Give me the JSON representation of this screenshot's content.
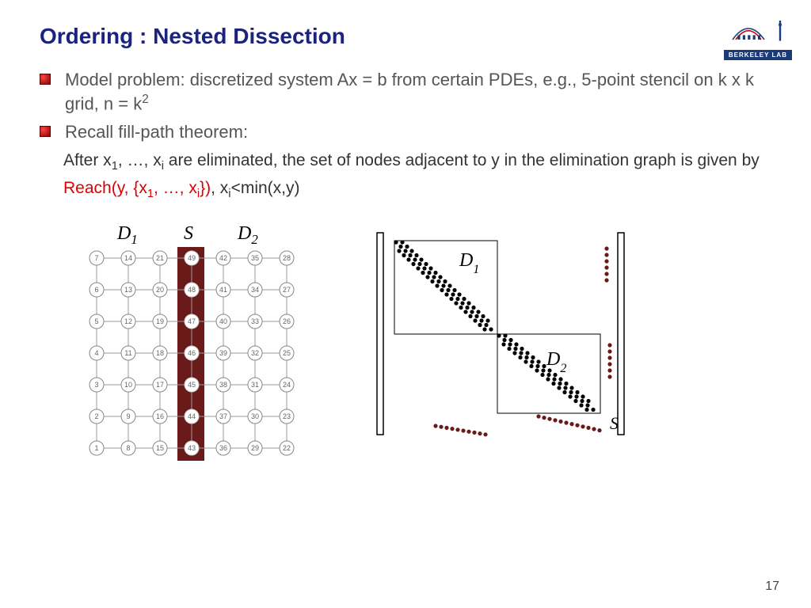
{
  "title": "Ordering : Nested Dissection",
  "logo": {
    "text": "BERKELEY LAB"
  },
  "bullets": [
    "Model problem: discretized system Ax = b from certain PDEs, e.g., 5-point stencil on  k x k grid,  n = k",
    "Recall fill-path theorem:"
  ],
  "k_exponent": "2",
  "subtext": {
    "part1": "After x",
    "s1": "1",
    "part2": ", …, x",
    "s2": "i",
    "part3": " are eliminated, the set of nodes adjacent to y in the elimination graph is given by ",
    "reach1": "Reach(y, {x",
    "rs1": "1",
    "reach2": ", …, x",
    "rs2": "i",
    "reach3": "})",
    "part4": ", x",
    "s3": "i",
    "part5": "<min(x,y)"
  },
  "grid_labels": {
    "D1": "D",
    "D1s": "1",
    "S": "S",
    "D2": "D",
    "D2s": "2"
  },
  "matrix_labels": {
    "D1": "D",
    "D1s": "1",
    "D2": "D",
    "D2s": "2",
    "S": "S"
  },
  "page": "17",
  "grid_numbers": {
    "col0": [
      7,
      6,
      5,
      4,
      3,
      2,
      1
    ],
    "col1": [
      14,
      13,
      12,
      11,
      10,
      9,
      8
    ],
    "col2": [
      21,
      20,
      19,
      18,
      17,
      16,
      15
    ],
    "col3": [
      49,
      48,
      47,
      46,
      45,
      44,
      43
    ],
    "col4": [
      42,
      41,
      40,
      39,
      38,
      37,
      36
    ],
    "col5": [
      35,
      34,
      33,
      32,
      31,
      30,
      29
    ],
    "col6": [
      28,
      27,
      26,
      25,
      24,
      23,
      22
    ]
  }
}
